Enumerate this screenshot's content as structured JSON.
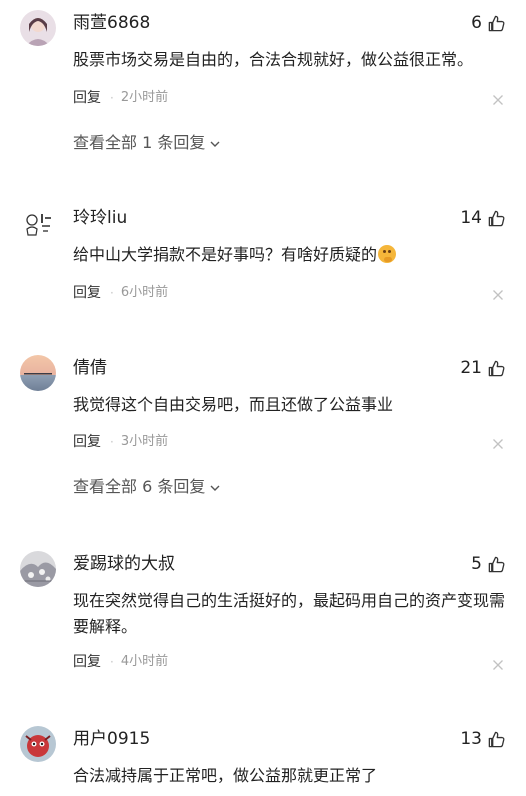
{
  "comments": [
    {
      "user": "雨萱6868",
      "likes": "6",
      "text": "股票市场交易是自由的，合法合规就好，做公益很正常。",
      "reply": "回复",
      "time": "2小时前",
      "more": "查看全部 1 条回复"
    },
    {
      "user": "玲玲liu",
      "likes": "14",
      "text": "给中山大学捐款不是好事吗？有啥好质疑的",
      "emoji": "thinking-face-emoji",
      "reply": "回复",
      "time": "6小时前"
    },
    {
      "user": "倩倩",
      "likes": "21",
      "text": "我觉得这个自由交易吧，而且还做了公益事业",
      "reply": "回复",
      "time": "3小时前",
      "more": "查看全部 6 条回复"
    },
    {
      "user": "爱踢球的大叔",
      "likes": "5",
      "text": "现在突然觉得自己的生活挺好的，最起码用自己的资产变现需要解释。",
      "reply": "回复",
      "time": "4小时前"
    },
    {
      "user": "用户0915",
      "likes": "13",
      "text": "合法减持属于正常吧，做公益那就更正常了"
    }
  ],
  "icons": {
    "like": "thumbs-up-icon",
    "dismiss": "close-icon",
    "expand": "chevron-down-icon"
  },
  "colors": {
    "text": "#222222",
    "meta": "#999999",
    "more": "#555555"
  }
}
